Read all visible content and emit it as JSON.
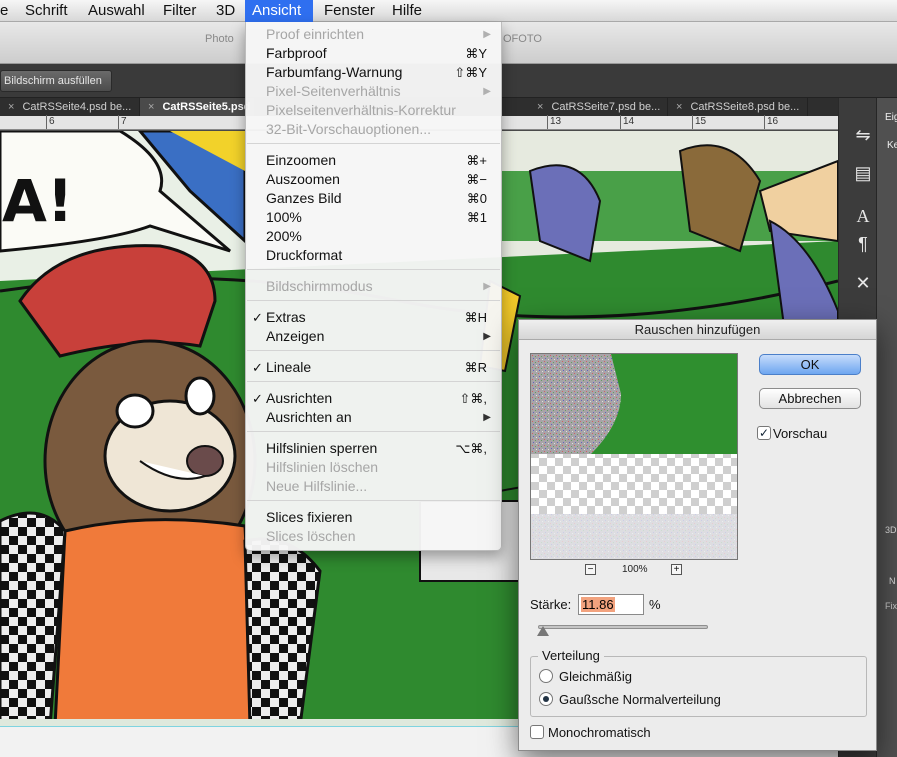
{
  "menubar": {
    "items": [
      {
        "label": "e"
      },
      {
        "label": "Schrift"
      },
      {
        "label": "Auswahl"
      },
      {
        "label": "Filter"
      },
      {
        "label": "3D"
      },
      {
        "label": "Ansicht"
      },
      {
        "label": "Fenster"
      },
      {
        "label": "Hilfe"
      }
    ],
    "active": "Ansicht"
  },
  "titlebar": {
    "left_fragment": "Photo",
    "right_fragment": "OFOTO"
  },
  "options": {
    "fit_screen_label": "Bildschirm ausfüllen"
  },
  "tabs": [
    {
      "label": "CatRSSeite4.psd be...",
      "close": "×"
    },
    {
      "label": "CatRSSeite5.psd",
      "close": "×"
    },
    {
      "label": "CatRSSeite7.psd be...",
      "close": "×"
    },
    {
      "label": "CatRSSeite8.psd be...",
      "close": "×"
    }
  ],
  "ruler": {
    "numbers": [
      "6",
      "7",
      "13",
      "14",
      "15",
      "16"
    ]
  },
  "artwork": {
    "speech_text": "A!"
  },
  "menu": {
    "items": [
      {
        "label": "Proof einrichten",
        "enabled": false,
        "submenu": true
      },
      {
        "label": "Farbproof",
        "shortcut": "⌘Y",
        "enabled": true
      },
      {
        "label": "Farbumfang-Warnung",
        "shortcut": "⇧⌘Y",
        "enabled": true
      },
      {
        "label": "Pixel-Seitenverhältnis",
        "enabled": false,
        "submenu": true
      },
      {
        "label": "Pixelseitenverhältnis-Korrektur",
        "enabled": false
      },
      {
        "label": "32-Bit-Vorschauoptionen...",
        "enabled": false
      },
      {
        "label": "Einzoomen",
        "shortcut": "⌘+",
        "enabled": true
      },
      {
        "label": "Auszoomen",
        "shortcut": "⌘−",
        "enabled": true
      },
      {
        "label": "Ganzes Bild",
        "shortcut": "⌘0",
        "enabled": true
      },
      {
        "label": "100%",
        "shortcut": "⌘1",
        "enabled": true
      },
      {
        "label": "200%",
        "enabled": true
      },
      {
        "label": "Druckformat",
        "enabled": true
      },
      {
        "label": "Bildschirmmodus",
        "enabled": false,
        "submenu": true
      },
      {
        "label": "Extras",
        "shortcut": "⌘H",
        "enabled": true,
        "checked": true
      },
      {
        "label": "Anzeigen",
        "enabled": true,
        "submenu": true
      },
      {
        "label": "Lineale",
        "shortcut": "⌘R",
        "enabled": true,
        "checked": true
      },
      {
        "label": "Ausrichten",
        "shortcut": "⇧⌘,",
        "enabled": true,
        "checked": true
      },
      {
        "label": "Ausrichten an",
        "enabled": true,
        "submenu": true
      },
      {
        "label": "Hilfslinien sperren",
        "shortcut": "⌥⌘,",
        "enabled": true
      },
      {
        "label": "Hilfslinien löschen",
        "enabled": false
      },
      {
        "label": "Neue Hilfslinie...",
        "enabled": false
      },
      {
        "label": "Slices fixieren",
        "enabled": true
      },
      {
        "label": "Slices löschen",
        "enabled": false
      }
    ],
    "checkmark": "✓",
    "submenu_arrow": "▶"
  },
  "dialog": {
    "title": "Rauschen hinzufügen",
    "ok_label": "OK",
    "cancel_label": "Abbrechen",
    "preview_label": "Vorschau",
    "preview_checked": true,
    "zoom_minus": "−",
    "zoom_plus": "+",
    "zoom": "100%",
    "amount_label": "Stärke:",
    "amount_value": "11.86",
    "amount_unit": "%",
    "amount_fraction": 0.03,
    "distribution_label": "Verteilung",
    "uniform_label": "Gleichmäßig",
    "gaussian_label": "Gaußsche Normalverteilung",
    "selected_distribution": "gaussian",
    "mono_label": "Monochromatisch",
    "mono_checked": false
  },
  "right_panel": {
    "labels": [
      "Eig",
      "Ke",
      "3D",
      "N",
      "Fix"
    ],
    "icons": [
      "mini-bridge-icon",
      "clipboard-icon",
      "character-icon",
      "paragraph-icon",
      "tools-icon"
    ]
  },
  "colors": {
    "accent": "#2f6ff0",
    "canvas_green": "#2a7d2a",
    "cap_red": "#c8403a",
    "shirt_orange": "#f07a3a",
    "fur_brown": "#7a5a3e"
  }
}
